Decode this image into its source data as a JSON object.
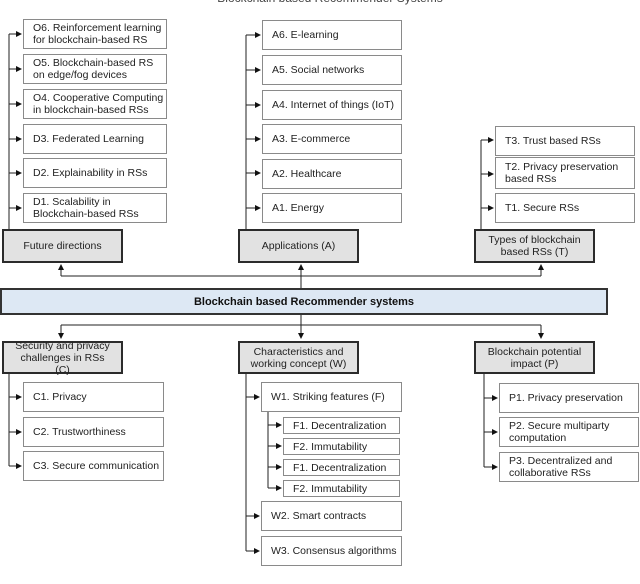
{
  "title": "Blockchain based Recommender Systems",
  "center": {
    "label": "Blockchain based Recommender systems"
  },
  "colors": {
    "center_fill": "#dde8f4",
    "category_fill": "#e2e2e2",
    "item_fill": "#ffffff"
  },
  "future": {
    "label": "Future directions",
    "items": [
      "O6. Reinforcement learning for blockchain-based RS",
      "O5. Blockchain-based RS on edge/fog devices",
      "O4. Cooperative Computing in blockchain-based RSs",
      "D3. Federated Learning",
      "D2. Explainability in RSs",
      "D1. Scalability in Blockchain-based RSs"
    ]
  },
  "applications": {
    "label": "Applications (A)",
    "items": [
      "A6. E-learning",
      "A5. Social networks",
      "A4. Internet of things (IoT)",
      "A3. E-commerce",
      "A2. Healthcare",
      "A1. Energy"
    ]
  },
  "types": {
    "label": "Types of blockchain based RSs (T)",
    "items": [
      "T3. Trust based RSs",
      "T2. Privacy preservation based RSs",
      "T1. Secure RSs"
    ]
  },
  "security": {
    "label": "Security and privacy challenges in RSs (C)",
    "items": [
      "C1. Privacy",
      "C2. Trustworthiness",
      "C3. Secure communication"
    ]
  },
  "characteristics": {
    "label": "Characteristics and working concept (W)",
    "w1": "W1. Striking features (F)",
    "features": [
      "F1. Decentralization",
      "F2. Immutability",
      "F1. Decentralization",
      "F2. Immutability"
    ],
    "w2": "W2. Smart contracts",
    "w3": "W3. Consensus algorithms"
  },
  "impact": {
    "label": "Blockchain potential impact (P)",
    "items": [
      "P1. Privacy preservation",
      "P2. Secure multiparty computation",
      "P3. Decentralized and collaborative RSs"
    ]
  }
}
